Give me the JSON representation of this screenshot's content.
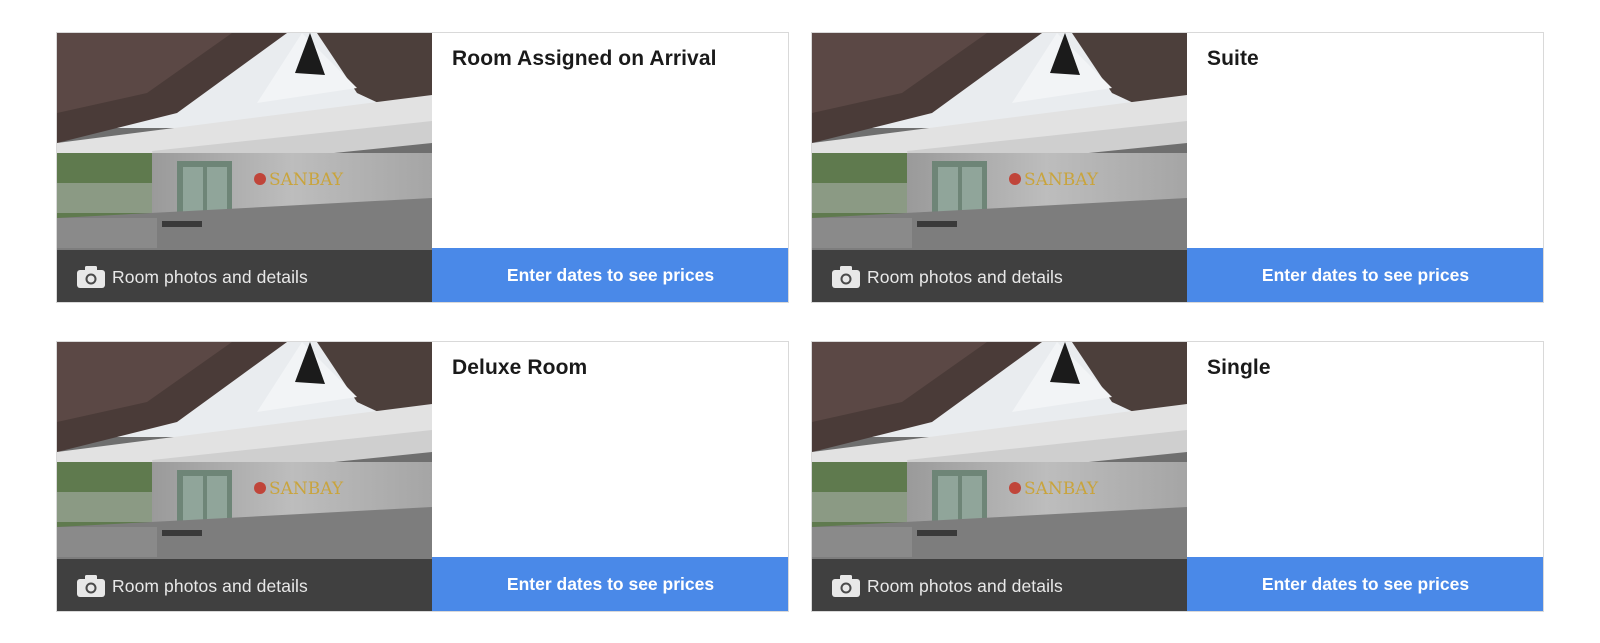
{
  "rooms": [
    {
      "title": "Room Assigned on Arrival",
      "photo_label": "Room photos and details",
      "button_label": "Enter dates to see prices"
    },
    {
      "title": "Suite",
      "photo_label": "Room photos and details",
      "button_label": "Enter dates to see prices"
    },
    {
      "title": "Deluxe Room",
      "photo_label": "Room photos and details",
      "button_label": "Enter dates to see prices"
    },
    {
      "title": "Single",
      "photo_label": "Room photos and details",
      "button_label": "Enter dates to see prices"
    }
  ],
  "photo_sign_text": "SANBAY",
  "photo_icon": "camera-icon",
  "colors": {
    "button": "#4a89e8",
    "photo_bar": "#3a3a3a",
    "border": "#d9d9d9"
  }
}
